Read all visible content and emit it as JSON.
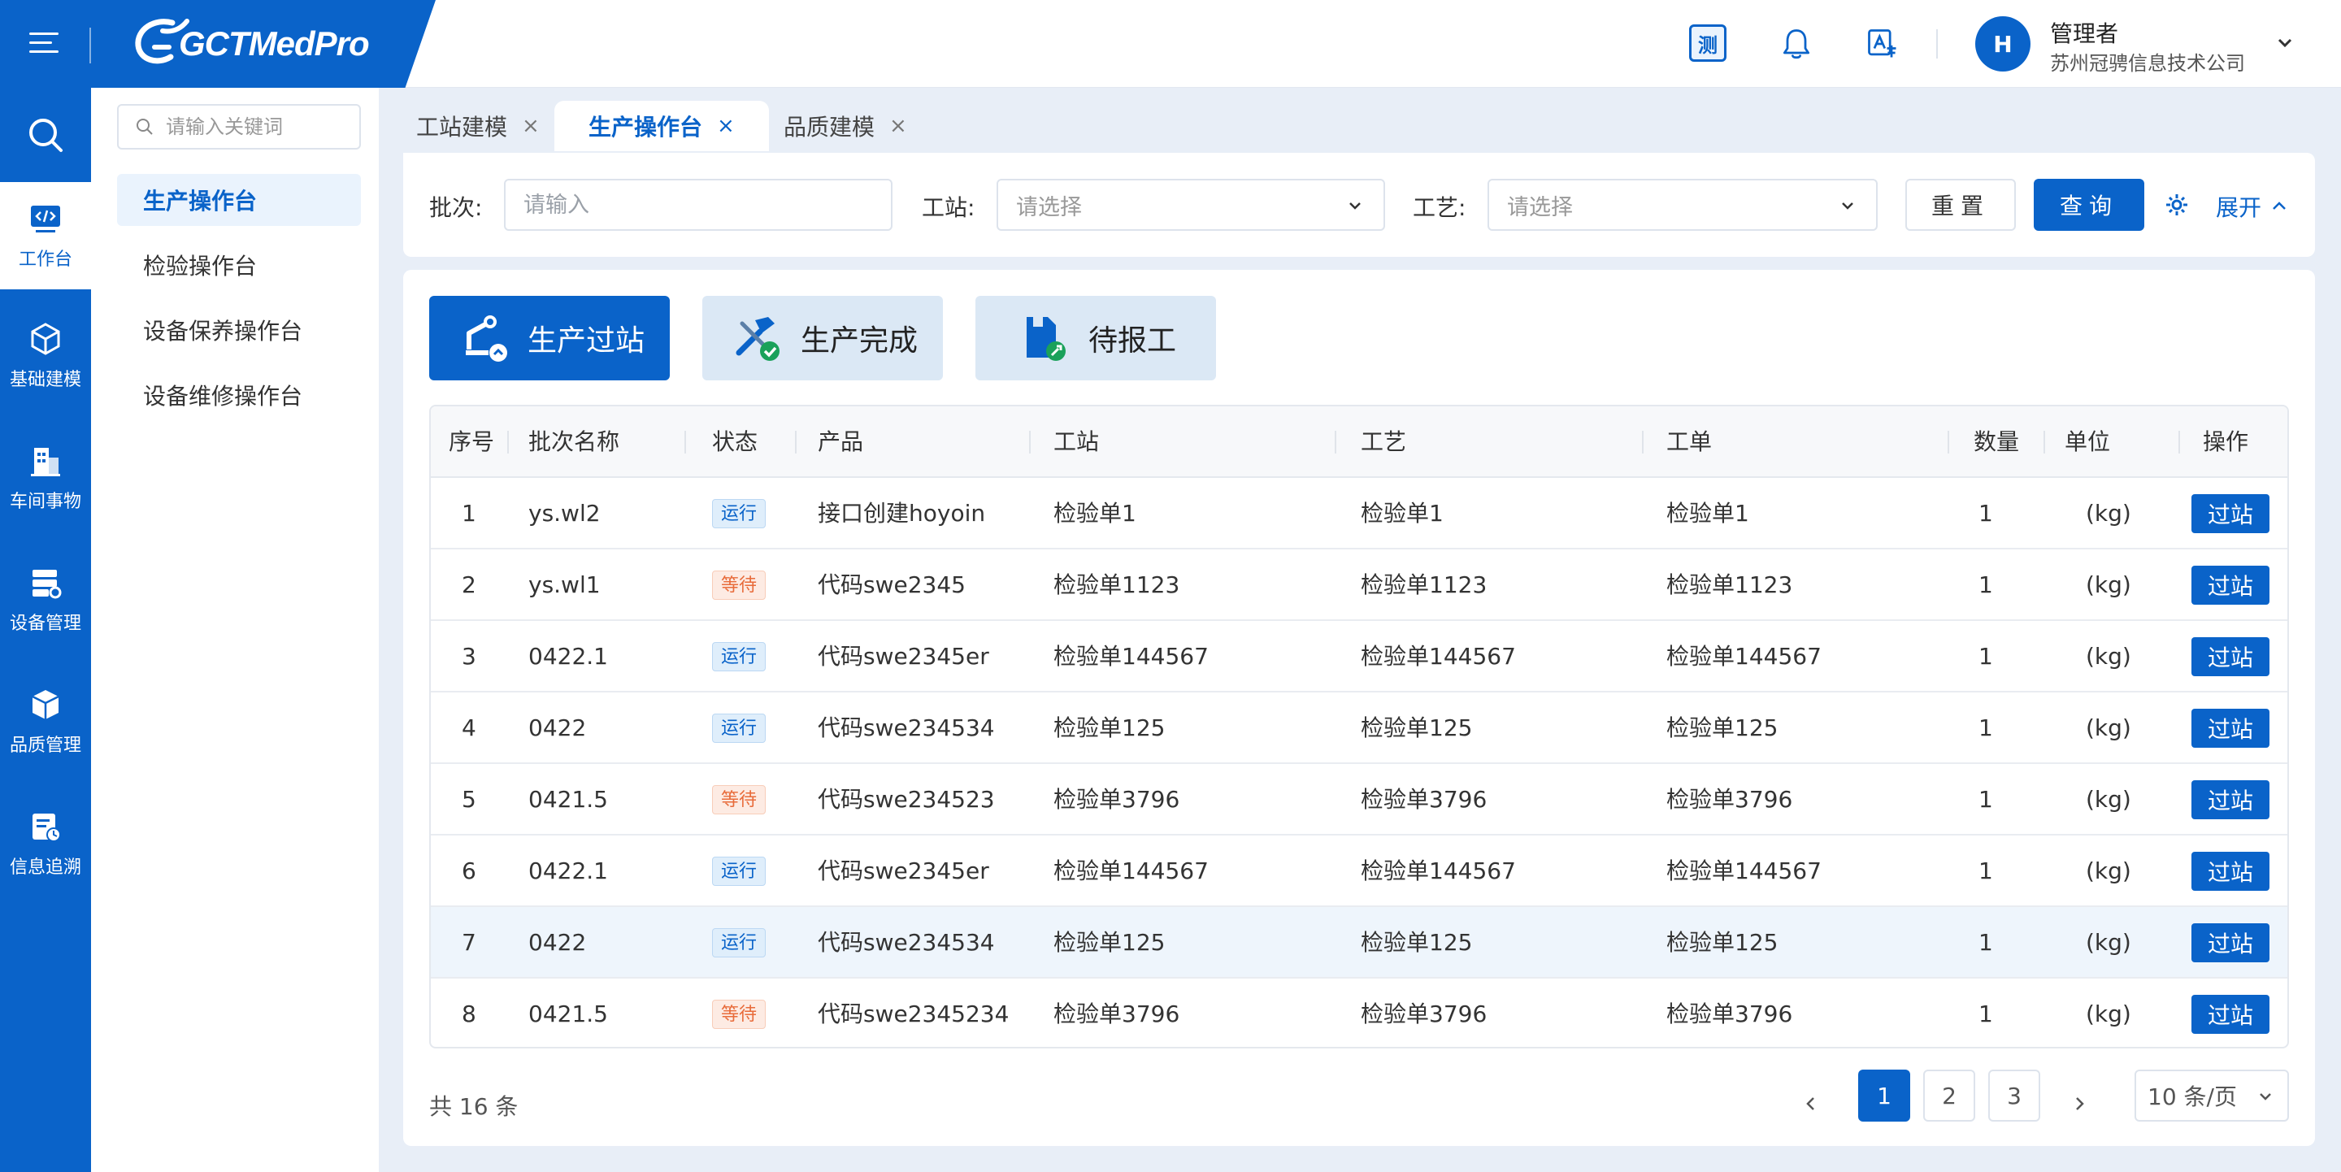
{
  "header": {
    "logo_text": "GCTMedPro",
    "test_icon_label": "测",
    "user_initial": "H",
    "user_name": "管理者",
    "user_org": "苏州冠骋信息技术公司"
  },
  "rail": {
    "items": [
      {
        "label": "工作台",
        "icon": "code-monitor-icon"
      },
      {
        "label": "基础建模",
        "icon": "cube-icon"
      },
      {
        "label": "车间事物",
        "icon": "building-icon"
      },
      {
        "label": "设备管理",
        "icon": "server-icon"
      },
      {
        "label": "品质管理",
        "icon": "box-icon"
      },
      {
        "label": "信息追溯",
        "icon": "tracking-icon"
      }
    ]
  },
  "submenu": {
    "search_placeholder": "请输入关键词",
    "items": [
      "生产操作台",
      "检验操作台",
      "设备保养操作台",
      "设备维修操作台"
    ]
  },
  "tabs": [
    {
      "label": "工站建模"
    },
    {
      "label": "生产操作台"
    },
    {
      "label": "品质建模"
    }
  ],
  "filter": {
    "batch_label": "批次:",
    "batch_placeholder": "请输入",
    "station_label": "工站:",
    "station_placeholder": "请选择",
    "process_label": "工艺:",
    "process_placeholder": "请选择",
    "reset_label": "重置",
    "query_label": "查询",
    "expand_label": "展开"
  },
  "actions": [
    "生产过站",
    "生产完成",
    "待报工"
  ],
  "table": {
    "columns": [
      "序号",
      "批次名称",
      "状态",
      "产品",
      "工站",
      "工艺",
      "工单",
      "数量",
      "单位",
      "操作"
    ],
    "action_label": "过站",
    "rows": [
      {
        "no": "1",
        "batch": "ys.wl2",
        "status": "运行",
        "kind": "run",
        "product": "接口创建hoyoin",
        "station": "检验单1",
        "process": "检验单1",
        "order": "检验单1",
        "qty": "1",
        "unit": "(kg)"
      },
      {
        "no": "2",
        "batch": "ys.wl1",
        "status": "等待",
        "kind": "wait",
        "product": "代码swe2345",
        "station": "检验单1123",
        "process": "检验单1123",
        "order": "检验单1123",
        "qty": "1",
        "unit": "(kg)"
      },
      {
        "no": "3",
        "batch": "0422.1",
        "status": "运行",
        "kind": "run",
        "product": "代码swe2345er",
        "station": "检验单144567",
        "process": "检验单144567",
        "order": "检验单144567",
        "qty": "1",
        "unit": "(kg)"
      },
      {
        "no": "4",
        "batch": "0422",
        "status": "运行",
        "kind": "run",
        "product": "代码swe234534",
        "station": "检验单125",
        "process": "检验单125",
        "order": "检验单125",
        "qty": "1",
        "unit": "(kg)"
      },
      {
        "no": "5",
        "batch": "0421.5",
        "status": "等待",
        "kind": "wait",
        "product": "代码swe234523",
        "station": "检验单3796",
        "process": "检验单3796",
        "order": "检验单3796",
        "qty": "1",
        "unit": "(kg)"
      },
      {
        "no": "6",
        "batch": "0422.1",
        "status": "运行",
        "kind": "run",
        "product": "代码swe2345er",
        "station": "检验单144567",
        "process": "检验单144567",
        "order": "检验单144567",
        "qty": "1",
        "unit": "(kg)"
      },
      {
        "no": "7",
        "batch": "0422",
        "status": "运行",
        "kind": "run",
        "product": "代码swe234534",
        "station": "检验单125",
        "process": "检验单125",
        "order": "检验单125",
        "qty": "1",
        "unit": "(kg)"
      },
      {
        "no": "8",
        "batch": "0421.5",
        "status": "等待",
        "kind": "wait",
        "product": "代码swe2345234",
        "station": "检验单3796",
        "process": "检验单3796",
        "order": "检验单3796",
        "qty": "1",
        "unit": "(kg)"
      }
    ]
  },
  "pagination": {
    "total_label": "共 16 条",
    "pages": [
      "1",
      "2",
      "3"
    ],
    "page_size": "10 条/页"
  },
  "colors": {
    "primary": "#0a63c9",
    "run": "#0a63c9",
    "wait": "#e86b3a"
  }
}
